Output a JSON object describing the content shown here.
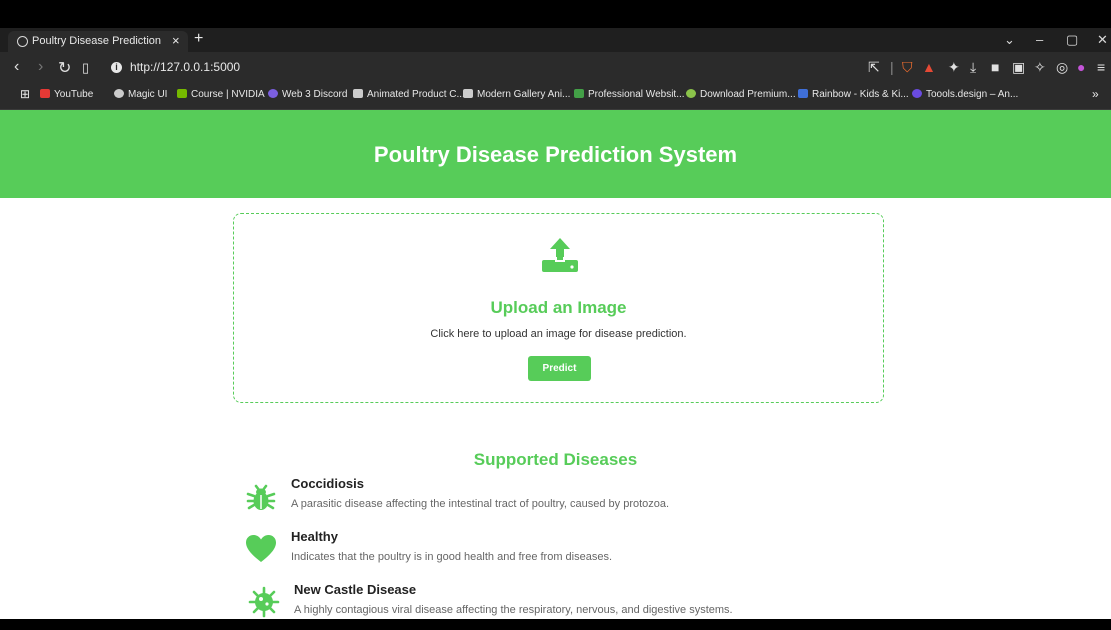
{
  "browser": {
    "tab_title": "Poultry Disease Prediction",
    "tab_close": "×",
    "new_tab": "+",
    "url": "http://127.0.0.1:5000",
    "window_controls": [
      "⌄",
      "–",
      "▢",
      "✕"
    ],
    "bookmarks": [
      {
        "label": "YouTube",
        "color": "#e53935"
      },
      {
        "label": "Magic UI",
        "color": "#cccccc"
      },
      {
        "label": "Course | NVIDIA",
        "color": "#76b900"
      },
      {
        "label": "Web 3 Discord",
        "color": "#7b5fe0"
      },
      {
        "label": "Animated Product C...",
        "color": "#cccccc"
      },
      {
        "label": "Modern Gallery Ani...",
        "color": "#cccccc"
      },
      {
        "label": "Professional Websit...",
        "color": "#43a047"
      },
      {
        "label": "Download Premium...",
        "color": "#8bc34a"
      },
      {
        "label": "Rainbow - Kids & Ki...",
        "color": "#3f6fd8"
      },
      {
        "label": "Toools.design – An...",
        "color": "#6a4be0"
      }
    ],
    "bookmarks_overflow": "»"
  },
  "header": {
    "title": "Poultry Disease Prediction System",
    "background": "#57cc59"
  },
  "upload": {
    "title": "Upload an Image",
    "description": "Click here to upload an image for disease prediction.",
    "button_label": "Predict",
    "accent": "#57cc59"
  },
  "diseases": {
    "title": "Supported Diseases",
    "items": [
      {
        "name": "Coccidiosis",
        "description": "A parasitic disease affecting the intestinal tract of poultry, caused by protozoa.",
        "icon": "bug-icon"
      },
      {
        "name": "Healthy",
        "description": "Indicates that the poultry is in good health and free from diseases.",
        "icon": "heart-icon"
      },
      {
        "name": "New Castle Disease",
        "description": "A highly contagious viral disease affecting the respiratory, nervous, and digestive systems.",
        "icon": "virus-icon"
      }
    ]
  }
}
